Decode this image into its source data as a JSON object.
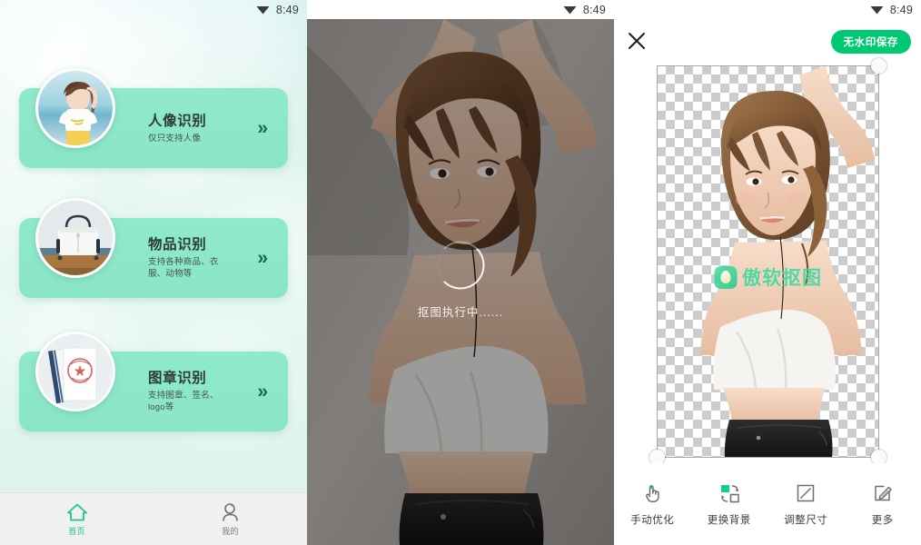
{
  "status_bar": {
    "time": "8:49",
    "wifi_icon": "wifi-icon"
  },
  "home": {
    "cards": [
      {
        "title": "人像识别",
        "subtitle": "仅只支持人像",
        "thumb_icon": "portrait-thumbnail",
        "chevron_icon": "double-chevron-right-icon"
      },
      {
        "title": "物品识别",
        "subtitle": "支持各种商品、衣服、动物等",
        "thumb_icon": "handbag-thumbnail",
        "chevron_icon": "double-chevron-right-icon"
      },
      {
        "title": "图章识别",
        "subtitle": "支持图章、签名、logo等",
        "thumb_icon": "stamp-document-thumbnail",
        "chevron_icon": "double-chevron-right-icon"
      }
    ],
    "tabs": [
      {
        "label": "首页",
        "icon": "home-icon",
        "active": true
      },
      {
        "label": "我的",
        "icon": "person-icon",
        "active": false
      }
    ]
  },
  "processing": {
    "label": "抠图执行中......",
    "spinner_icon": "loading-spinner-icon"
  },
  "result": {
    "close_icon": "close-icon",
    "save_label": "无水印保存",
    "watermark_text": "傲软抠图",
    "watermark_logo_icon": "app-logo-icon",
    "toolbar": [
      {
        "label": "手动优化",
        "icon": "hand-pointer-icon"
      },
      {
        "label": "更换背景",
        "icon": "swap-background-icon"
      },
      {
        "label": "调整尺寸",
        "icon": "resize-icon"
      },
      {
        "label": "更多",
        "icon": "edit-pencil-icon"
      }
    ],
    "handles": [
      "crop-handle-bottom-left",
      "crop-handle-bottom-right",
      "crop-handle-top-right"
    ]
  },
  "colors": {
    "accent_green": "#00c974",
    "card_mint": "#8ae6c7",
    "watermark_green": "#3fd69d",
    "tab_active": "#17c98a"
  }
}
